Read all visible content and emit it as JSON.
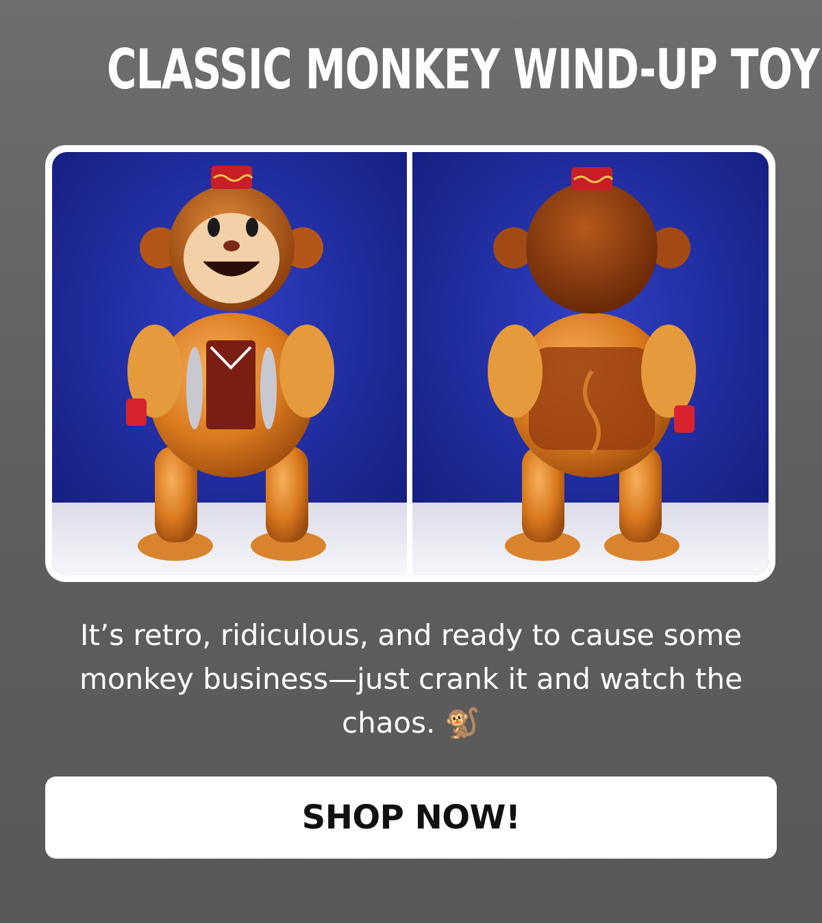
{
  "headline": "CLASSIC MONKEY WIND-UP TOY!",
  "body_text": "It’s retro, ridiculous, and ready to cause some monkey business—just crank it and watch the chaos. 🐒",
  "cta": {
    "label": "SHOP NOW!"
  },
  "images": {
    "left": {
      "icon": "monkey-toy-front-photo"
    },
    "right": {
      "icon": "monkey-toy-back-photo"
    }
  },
  "colors": {
    "background": "#666666",
    "backdrop_blue": "#1e2a9e",
    "toy_amber": "#e08a2a",
    "button_bg": "#ffffff",
    "button_text": "#111111"
  }
}
